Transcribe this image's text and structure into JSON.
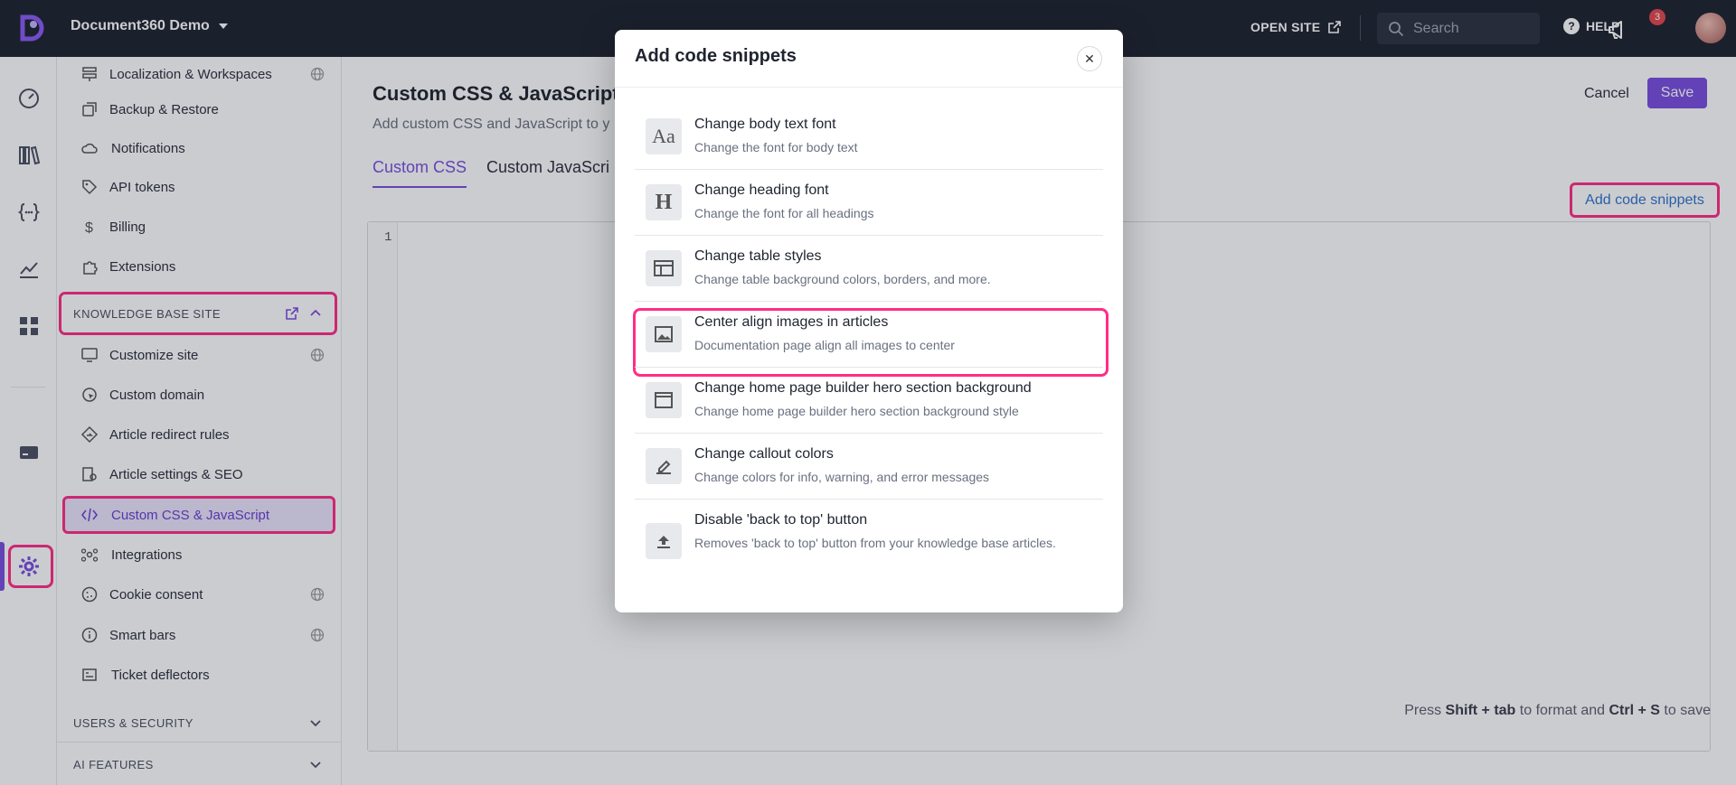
{
  "topbar": {
    "project_name": "Document360 Demo",
    "open_site_label": "OPEN SITE",
    "search_placeholder": "Search",
    "help_label": "HELP",
    "notification_count": "3"
  },
  "sidebar": {
    "top_items": [
      {
        "label": "Localization & Workspaces",
        "icon": "translate-icon",
        "globe": true
      },
      {
        "label": "Backup & Restore",
        "icon": "backup-icon",
        "globe": false
      },
      {
        "label": "Notifications",
        "icon": "notification-cloud-icon",
        "globe": false
      },
      {
        "label": "API tokens",
        "icon": "tag-icon",
        "globe": false
      },
      {
        "label": "Billing",
        "icon": "dollar-icon",
        "globe": false
      },
      {
        "label": "Extensions",
        "icon": "puzzle-icon",
        "globe": false
      }
    ],
    "kb_section_label": "KNOWLEDGE BASE SITE",
    "kb_items": [
      {
        "label": "Customize site",
        "icon": "monitor-icon",
        "globe": true
      },
      {
        "label": "Custom domain",
        "icon": "globe-pointer-icon",
        "globe": false
      },
      {
        "label": "Article redirect rules",
        "icon": "redirect-diamond-icon",
        "globe": false
      },
      {
        "label": "Article settings & SEO",
        "icon": "article-settings-icon",
        "globe": false
      },
      {
        "label": "Custom CSS & JavaScript",
        "icon": "code-icon",
        "globe": false
      },
      {
        "label": "Integrations",
        "icon": "integrations-icon",
        "globe": false
      },
      {
        "label": "Cookie consent",
        "icon": "cookie-icon",
        "globe": true
      },
      {
        "label": "Smart bars",
        "icon": "info-circle-icon",
        "globe": true
      },
      {
        "label": "Ticket deflectors",
        "icon": "ticket-icon",
        "globe": false
      }
    ],
    "users_section_label": "USERS & SECURITY",
    "ai_section_label": "AI FEATURES"
  },
  "main": {
    "title": "Custom CSS & JavaScript",
    "subtitle": "Add custom CSS and JavaScript to y",
    "cancel_label": "Cancel",
    "save_label": "Save",
    "tabs": [
      {
        "label": "Custom CSS"
      },
      {
        "label": "Custom JavaScri"
      }
    ],
    "add_snippets_label": "Add code snippets",
    "editor_line": "1",
    "hint_pre": "Press ",
    "hint_k1": "Shift + tab",
    "hint_mid": " to format and ",
    "hint_k2": "Ctrl + S",
    "hint_post": " to save"
  },
  "modal": {
    "title": "Add code snippets",
    "snippets": [
      {
        "title": "Change body text font",
        "desc": "Change the font for body text",
        "icon": "font-aa-icon"
      },
      {
        "title": "Change heading font",
        "desc": "Change the font for all headings",
        "icon": "heading-h-icon"
      },
      {
        "title": "Change table styles",
        "desc": "Change table background colors, borders, and more.",
        "icon": "table-icon"
      },
      {
        "title": "Center align images in articles",
        "desc": "Documentation page align all images to center",
        "icon": "image-icon"
      },
      {
        "title": "Change home page builder hero section background",
        "desc": "Change home page builder hero section background style",
        "icon": "browser-window-icon"
      },
      {
        "title": "Change callout colors",
        "desc": "Change colors for info, warning, and error messages",
        "icon": "highlighter-icon"
      },
      {
        "title": "Disable 'back to top' button",
        "desc": "Removes 'back to top' button from your knowledge base articles.",
        "icon": "upload-arrow-icon"
      }
    ]
  },
  "colors": {
    "accent": "#7a4fe0",
    "highlight": "#ff2d87",
    "topbar": "#1e2330",
    "link": "#2f74d0"
  }
}
